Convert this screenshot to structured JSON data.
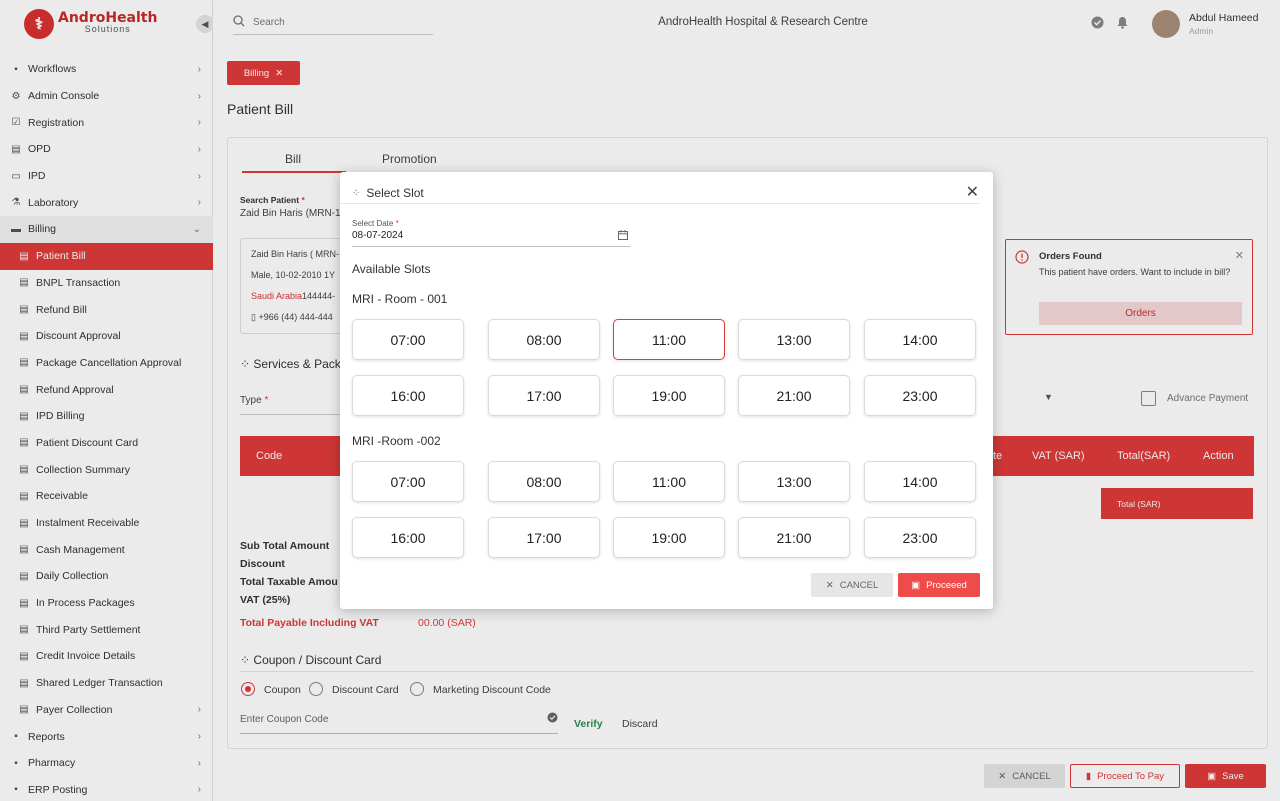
{
  "brand": {
    "name": "AndroHealth",
    "sub": "Solutions"
  },
  "topbar": {
    "search_placeholder": "Search",
    "hospital": "AndroHealth Hospital & Research Centre",
    "user_name": "Abdul Hameed",
    "user_role": "Admin"
  },
  "sidebar": {
    "items": [
      {
        "label": "Workflows",
        "icon": "workflow-icon",
        "chevron": true
      },
      {
        "label": "Admin Console",
        "icon": "gear-icon",
        "chevron": true
      },
      {
        "label": "Registration",
        "icon": "clipboard-icon",
        "chevron": true
      },
      {
        "label": "OPD",
        "icon": "opd-icon",
        "chevron": true
      },
      {
        "label": "IPD",
        "icon": "bed-icon",
        "chevron": true
      },
      {
        "label": "Laboratory",
        "icon": "flask-icon",
        "chevron": true
      },
      {
        "label": "Billing",
        "icon": "billing-icon",
        "chevron": true,
        "open": true
      }
    ],
    "billing_items": [
      "Patient Bill",
      "BNPL Transaction",
      "Refund Bill",
      "Discount Approval",
      "Package Cancellation Approval",
      "Refund Approval",
      "IPD Billing",
      "Patient Discount Card",
      "Collection Summary",
      "Receivable",
      "Instalment Receivable",
      "Cash Management",
      "Daily Collection",
      "In Process Packages",
      "Third Party Settlement",
      "Credit Invoice Details",
      "Shared Ledger Transaction",
      "Payer Collection"
    ],
    "bottom_items": [
      "Reports",
      "Pharmacy",
      "ERP Posting"
    ]
  },
  "main": {
    "chip": "Billing",
    "page_title": "Patient Bill",
    "tabs": [
      "Bill",
      "Promotion"
    ],
    "search_patient_label": "Search Patient",
    "search_patient_value": "Zaid Bin Haris (MRN-1",
    "patient": {
      "name": "Zaid Bin Haris ( MRN-",
      "info": "Male, 10-02-2010 1Y",
      "country": "Saudi Arabia",
      "id": "144444-",
      "phone": "+966 (44) 444-444"
    },
    "services_title": "Services & Packa",
    "type_label": "Type",
    "advance_payment": "Advance Payment",
    "table_headers": {
      "code": "Code",
      "vat_partial": "te",
      "vat": "VAT (SAR)",
      "total": "Total(SAR)",
      "action": "Action"
    },
    "total_box": "Total (SAR)",
    "summary": {
      "sub_total": "Sub Total Amount",
      "discount": "Discount",
      "taxable": "Total Taxable Amou",
      "vat": "VAT (25%)",
      "payable": "Total Payable Including VAT",
      "payable_value": "00.00 (SAR)"
    },
    "orders": {
      "title": "Orders Found",
      "message": "This patient have orders. Want to include in bill?",
      "button": "Orders"
    },
    "coupon": {
      "title": "Coupon / Discount Card",
      "options": [
        "Coupon",
        "Discount Card",
        "Marketing Discount Code"
      ],
      "placeholder": "Enter Coupon Code",
      "verify": "Verify",
      "discard": "Discard"
    },
    "footer": {
      "cancel": "CANCEL",
      "proceed_to_pay": "Proceed To Pay",
      "save": "Save"
    }
  },
  "modal": {
    "title": "Select Slot",
    "date_label": "Select Date",
    "date_value": "08-07-2024",
    "available": "Available Slots",
    "rooms": [
      {
        "name": "MRI - Room - 001",
        "slots": [
          "07:00",
          "08:00",
          "11:00",
          "13:00",
          "14:00",
          "16:00",
          "17:00",
          "19:00",
          "21:00",
          "23:00"
        ],
        "selected": "11:00"
      },
      {
        "name": "MRI -Room -002",
        "slots": [
          "07:00",
          "08:00",
          "11:00",
          "13:00",
          "14:00",
          "16:00",
          "17:00",
          "19:00",
          "21:00",
          "23:00"
        ]
      }
    ],
    "cancel": "CANCEL",
    "proceed": "Proceeed"
  },
  "colors": {
    "accent": "#e03b3b"
  }
}
